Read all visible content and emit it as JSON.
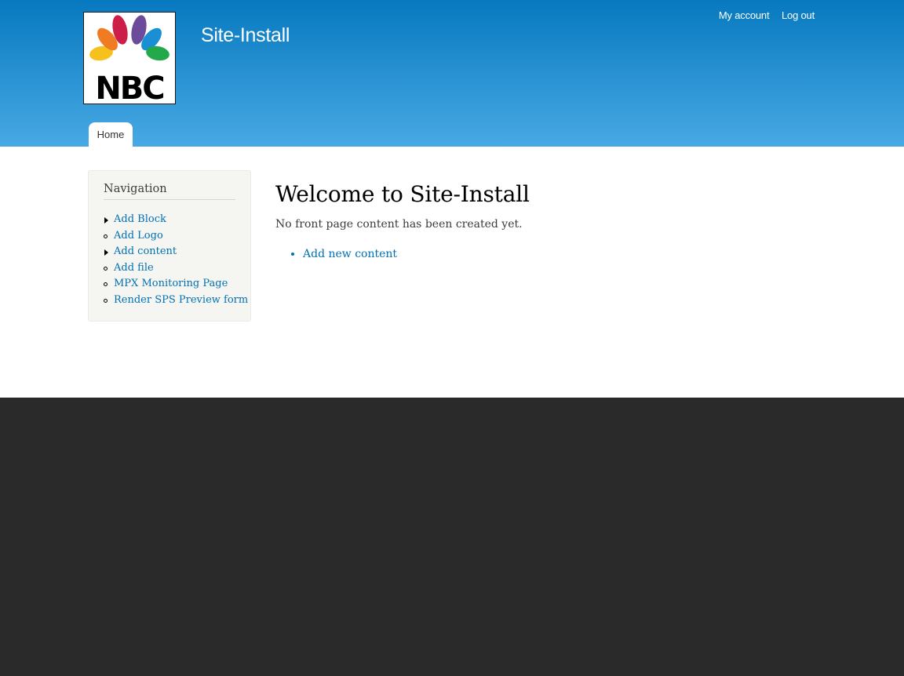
{
  "header": {
    "site_name": "Site-Install",
    "logo_text": "NBC",
    "secondary_menu": [
      "My account",
      "Log out"
    ],
    "primary_tabs": [
      "Home"
    ]
  },
  "sidebar": {
    "title": "Navigation",
    "items": [
      {
        "label": "Add Block",
        "bullet": "expandable"
      },
      {
        "label": "Add Logo",
        "bullet": "leaf"
      },
      {
        "label": "Add content",
        "bullet": "expandable"
      },
      {
        "label": "Add file",
        "bullet": "leaf"
      },
      {
        "label": "MPX Monitoring Page",
        "bullet": "leaf"
      },
      {
        "label": "Render SPS Preview form",
        "bullet": "leaf"
      }
    ]
  },
  "main": {
    "title": "Welcome to Site-Install",
    "intro": "No front page content has been created yet.",
    "links": [
      "Add new content"
    ]
  },
  "colors": {
    "header_top": "#0779bf",
    "header_bottom": "#48a9e4",
    "link": "#0071b3",
    "sidebar_bg": "#f5f5f2",
    "footer_bg": "#2a2a2a"
  }
}
